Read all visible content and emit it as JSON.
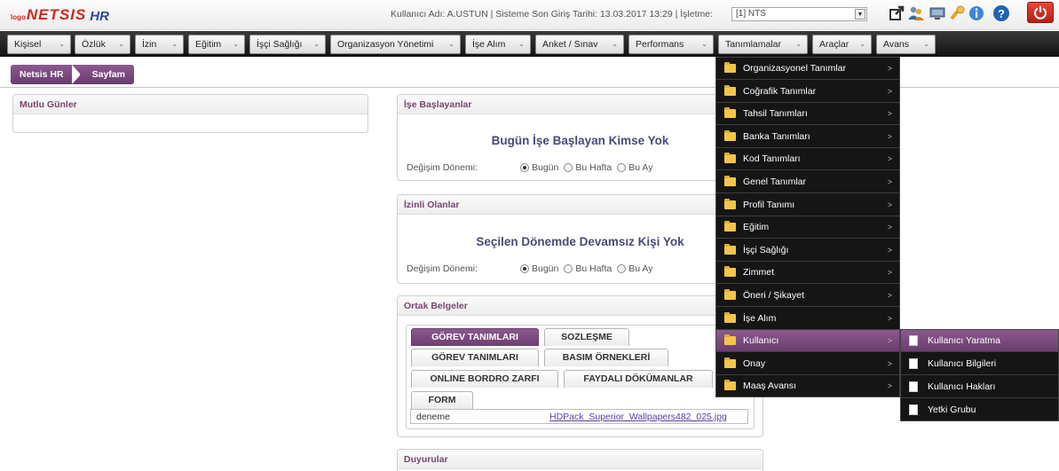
{
  "app": {
    "logo_prefix": "logo",
    "logo_brand": "NETSIS",
    "logo_suffix": "HR"
  },
  "topbar": {
    "user_info": "Kullanıcı Adı: A.USTUN | Sisteme Son Giriş Tarihi: 13.03.2017 13:29 | İşletme:",
    "company_value": "[1] NTS"
  },
  "nav": {
    "items": [
      "Kişisel",
      "Özlük",
      "İzin",
      "Eğitim",
      "İşçi Sağlığı",
      "Organizasyon Yönetimi",
      "İşe Alım",
      "Anket / Sınav",
      "Performans",
      "Tanımlamalar",
      "Araçlar",
      "Avans"
    ]
  },
  "breadcrumb": [
    "Netsis HR",
    "Sayfam"
  ],
  "panels": {
    "mutlu_gunler": {
      "title": "Mutlu Günler"
    },
    "ise_baslayanlar": {
      "title": "İşe Başlayanlar",
      "message": "Bugün İşe Başlayan Kimse Yok",
      "period_label": "Değişim Dönemi:",
      "options": [
        "Bugün",
        "Bu Hafta",
        "Bu Ay"
      ],
      "selected": "Bugün"
    },
    "izinli_olanlar": {
      "title": "İzinli Olanlar",
      "message": "Seçilen Dönemde Devamsız Kişi Yok",
      "period_label": "Değişim Dönemi:",
      "options": [
        "Bugün",
        "Bu Hafta",
        "Bu Ay"
      ],
      "selected": "Bugün"
    },
    "ortak_belgeler": {
      "title": "Ortak Belgeler",
      "tabs": [
        "GÖREV TANIMLARI",
        "SOZLEŞME",
        "GÖREV TANIMLARI",
        "BASIM ÖRNEKLERİ",
        "ONLINE BORDRO ZARFI",
        "FAYDALI DÖKÜMANLAR",
        "FORM"
      ],
      "active_tab": "GÖREV TANIMLARI",
      "row": {
        "name": "deneme",
        "file": "HDPack_Superior_Wallpapers482_025.jpg"
      }
    },
    "duyurular": {
      "title": "Duyurular"
    }
  },
  "tanimlamalar_menu": {
    "items": [
      "Organizasyonel Tanımlar",
      "Coğrafik Tanımlar",
      "Tahsil Tanımları",
      "Banka Tanımları",
      "Kod Tanımları",
      "Genel Tanımlar",
      "Profil Tanımı",
      "Eğitim",
      "İşçi Sağlığı",
      "Zimmet",
      "Öneri / Şikayet",
      "İşe Alım",
      "Kullanıcı",
      "Onay",
      "Maaş Avansı"
    ],
    "highlighted": "Kullanıcı",
    "arrow": ">"
  },
  "kullanici_submenu": {
    "items": [
      "Kullanıcı Yaratma",
      "Kullanıcı Bilgileri",
      "Kullanıcı Hakları",
      "Yetki Grubu"
    ],
    "highlighted": "Kullanıcı Yaratma"
  },
  "colors": {
    "accent": "#7a4a7e",
    "nav_bg": "#1a1a1a",
    "menu_bg": "#151515"
  }
}
